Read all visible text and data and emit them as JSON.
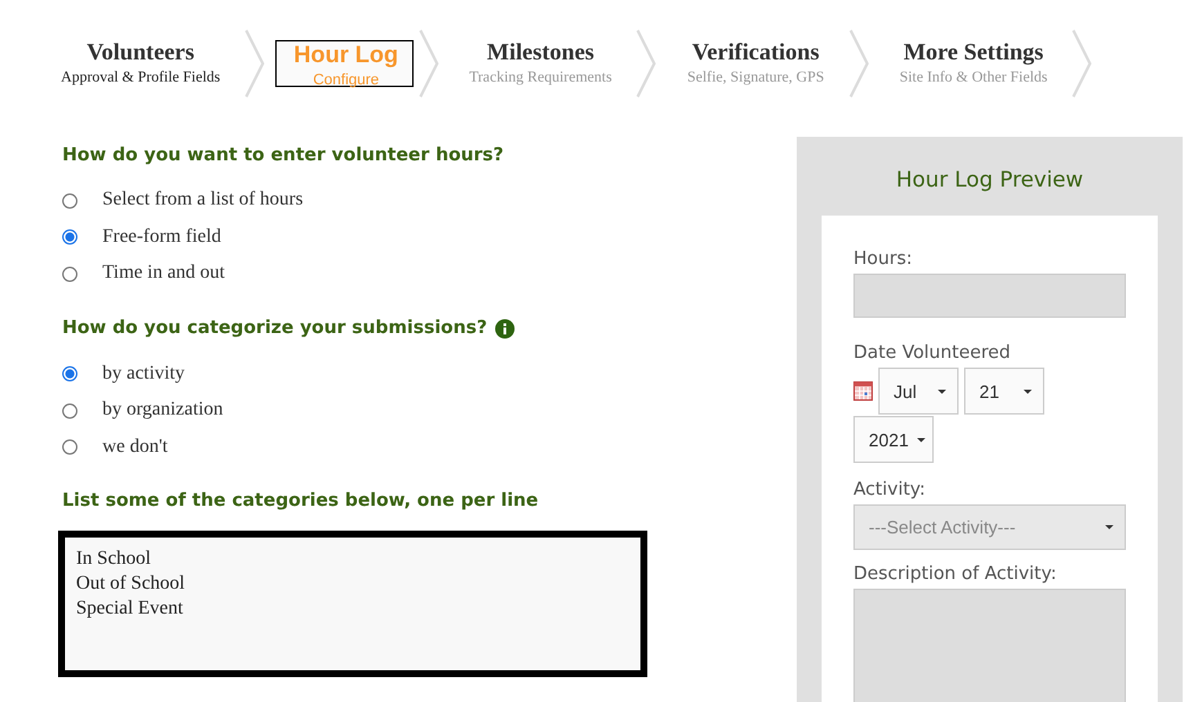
{
  "steps": [
    {
      "title": "Volunteers",
      "subtitle": "Approval & Profile Fields",
      "selected": false,
      "done": true
    },
    {
      "title": "Hour Log",
      "subtitle": "Configure",
      "selected": true,
      "done": false
    },
    {
      "title": "Milestones",
      "subtitle": "Tracking Requirements",
      "selected": false,
      "done": false
    },
    {
      "title": "Verifications",
      "subtitle": "Selfie, Signature, GPS",
      "selected": false,
      "done": false
    },
    {
      "title": "More Settings",
      "subtitle": "Site Info & Other Fields",
      "selected": false,
      "done": false
    }
  ],
  "questions": [
    {
      "heading": "How do you want to enter volunteer hours?",
      "info": false,
      "options": [
        {
          "label": "Select from a list of hours",
          "selected": false
        },
        {
          "label": "Free-form field",
          "selected": true
        },
        {
          "label": "Time in and out",
          "selected": false
        }
      ]
    },
    {
      "heading": "How do you categorize your submissions?",
      "info": true,
      "options": [
        {
          "label": "by activity",
          "selected": true
        },
        {
          "label": "by organization",
          "selected": false
        },
        {
          "label": "we don't",
          "selected": false
        }
      ]
    }
  ],
  "categories": {
    "heading": "List some of the categories below, one per line",
    "value": "In School\nOut of School\nSpecial Event"
  },
  "preview": {
    "title": "Hour Log Preview",
    "hours_label": "Hours:",
    "date_label": "Date Volunteered",
    "month": "Jul",
    "day": "21",
    "year": "2021",
    "activity_label": "Activity:",
    "activity_placeholder": "---Select Activity---",
    "description_label": "Description of Activity:"
  }
}
